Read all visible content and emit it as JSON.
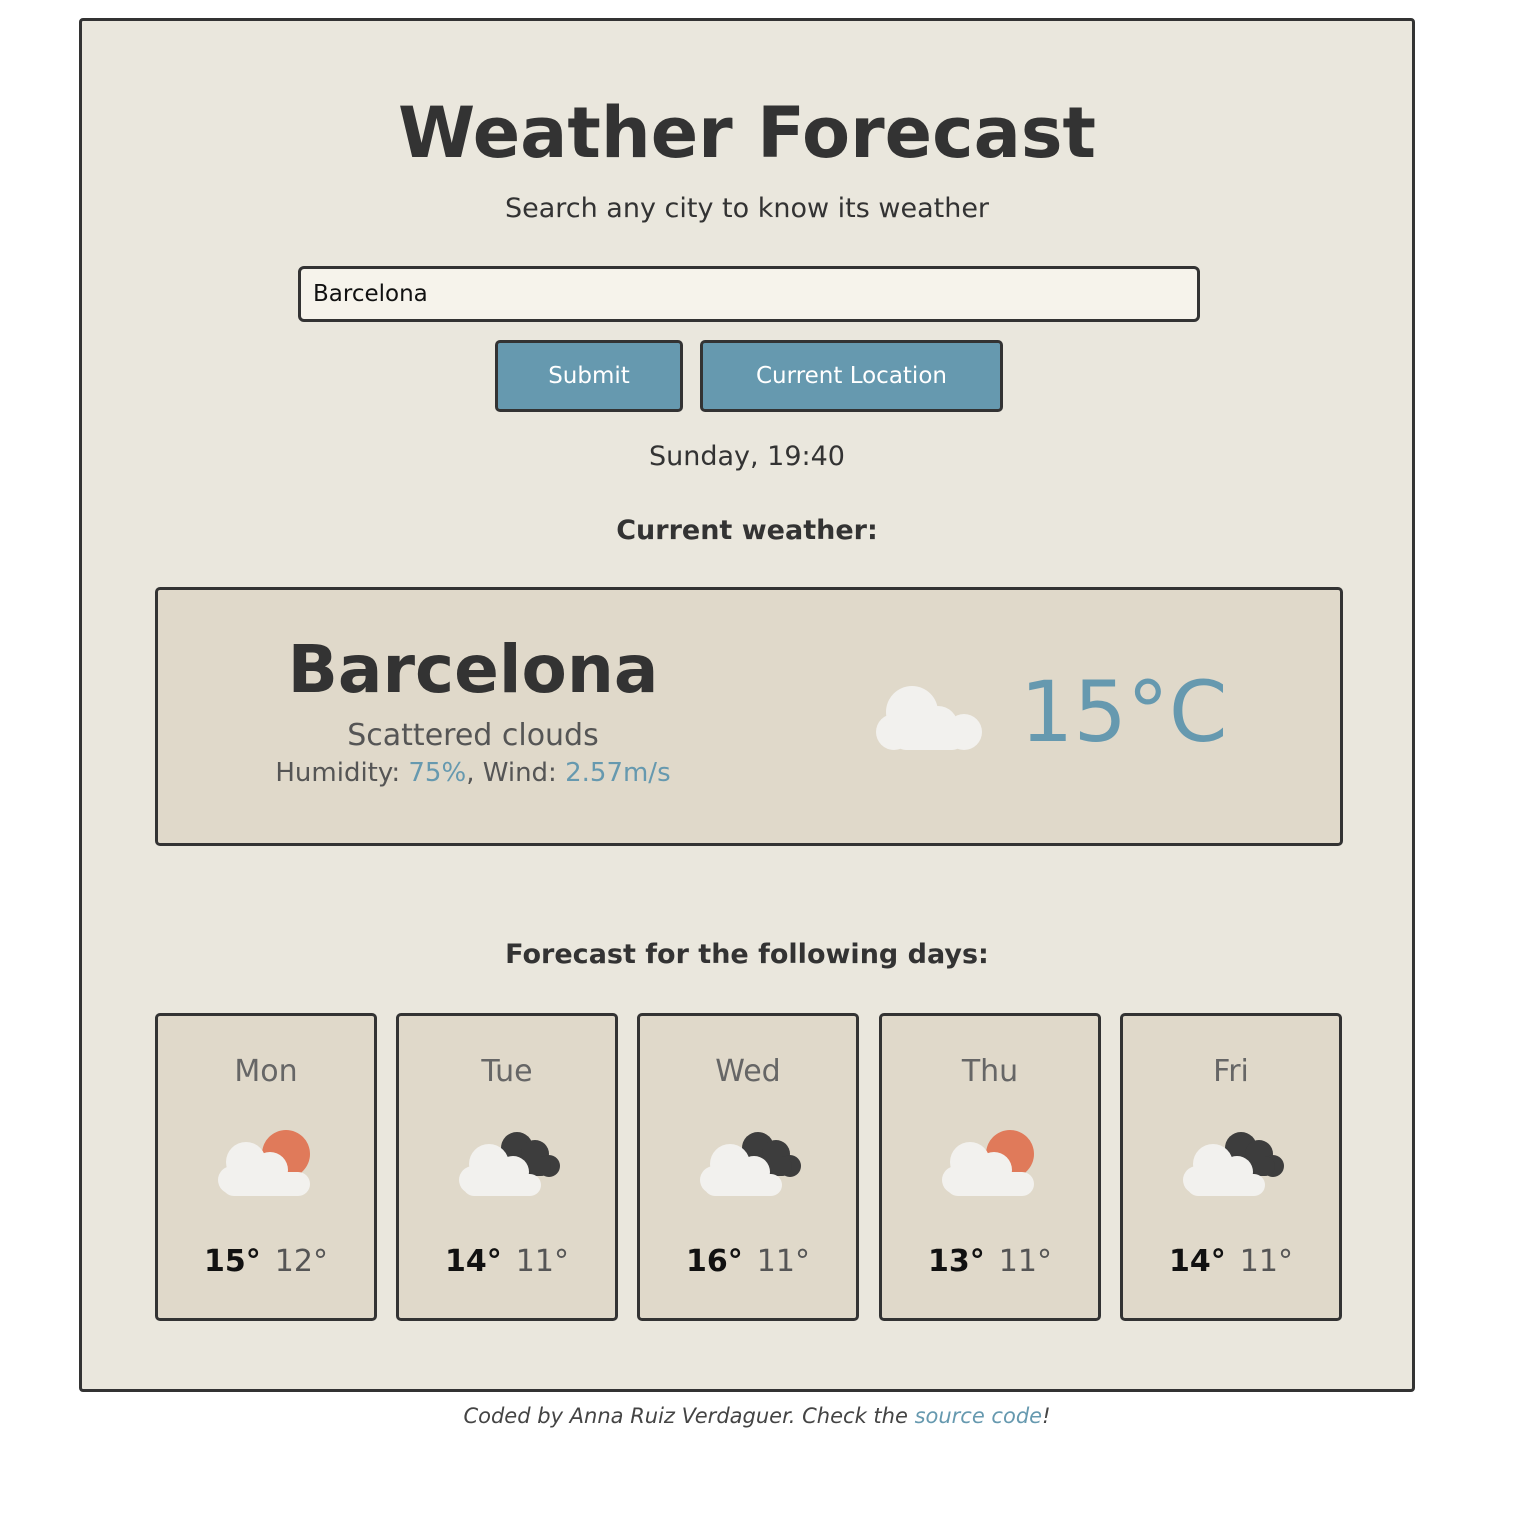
{
  "header": {
    "title": "Weather Forecast",
    "subtitle": "Search any city to know its weather"
  },
  "search": {
    "value": "Barcelona",
    "submit_label": "Submit",
    "location_label": "Current Location"
  },
  "datetime": "Sunday, 19:40",
  "current": {
    "heading": "Current weather:",
    "city": "Barcelona",
    "description": "Scattered clouds",
    "humidity_label": "Humidity: ",
    "humidity_value": "75%",
    "wind_label": ", Wind: ",
    "wind_value": "2.57m/s",
    "temperature": "15°C",
    "icon": "cloud-icon"
  },
  "forecast": {
    "heading": "Forecast for the following days:",
    "days": [
      {
        "day": "Mon",
        "max": "15°",
        "min": "12°",
        "icon": "cloud-sun-icon"
      },
      {
        "day": "Tue",
        "max": "14°",
        "min": "11°",
        "icon": "broken-clouds-icon"
      },
      {
        "day": "Wed",
        "max": "16°",
        "min": "11°",
        "icon": "broken-clouds-icon"
      },
      {
        "day": "Thu",
        "max": "13°",
        "min": "11°",
        "icon": "cloud-sun-icon"
      },
      {
        "day": "Fri",
        "max": "14°",
        "min": "11°",
        "icon": "broken-clouds-icon"
      }
    ]
  },
  "footer": {
    "prefix": "Coded by Anna Ruiz Verdaguer. Check the ",
    "link_text": "source code",
    "suffix": "!"
  },
  "colors": {
    "background": "#eae7dd",
    "card": "#e0d9ca",
    "accent": "#6699af",
    "text": "#333333",
    "sun": "#e07a5a",
    "dark_cloud": "#3d3d3d",
    "light_cloud": "#f2f1ee"
  }
}
